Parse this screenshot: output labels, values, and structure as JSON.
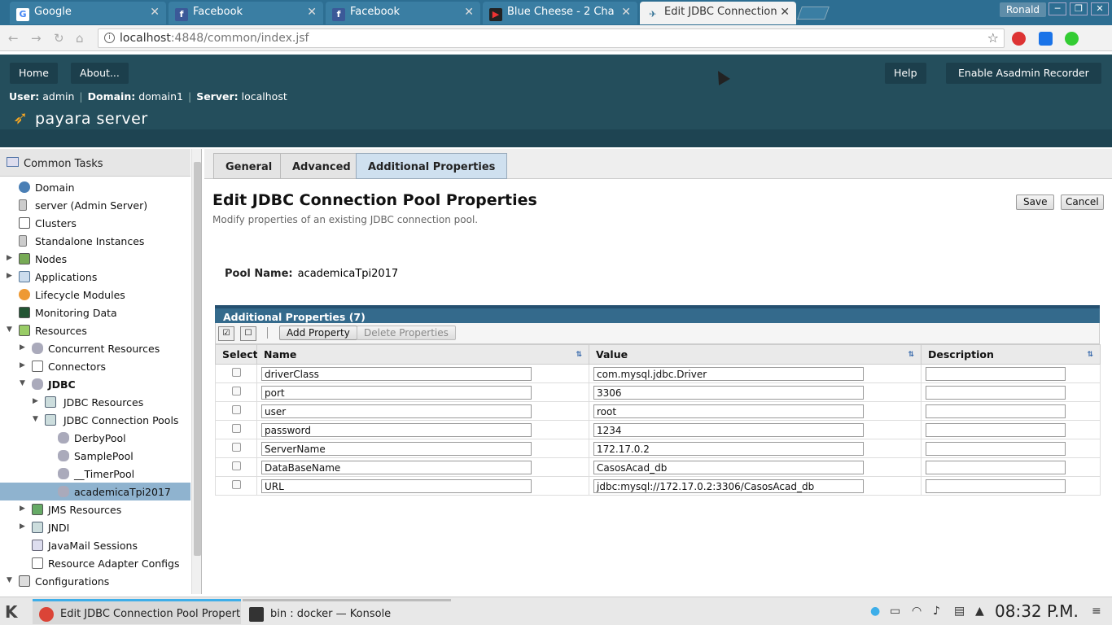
{
  "browser": {
    "tabs": [
      {
        "title": "Google"
      },
      {
        "title": "Facebook"
      },
      {
        "title": "Facebook"
      },
      {
        "title": "Blue Cheese - 2 Cha"
      },
      {
        "title": "Edit JDBC Connection"
      }
    ],
    "user_badge": "Ronald",
    "url_host": "localhost",
    "url_path": ":4848/common/index.jsf"
  },
  "masthead": {
    "home": "Home",
    "about": "About...",
    "help": "Help",
    "recorder": "Enable Asadmin Recorder",
    "user_label": "User:",
    "user_value": "admin",
    "domain_label": "Domain:",
    "domain_value": "domain1",
    "server_label": "Server:",
    "server_value": "localhost",
    "logo": "payara server"
  },
  "sidebar": {
    "header": "Common Tasks",
    "items": [
      {
        "label": "Domain"
      },
      {
        "label": "server (Admin Server)"
      },
      {
        "label": "Clusters"
      },
      {
        "label": "Standalone Instances"
      },
      {
        "label": "Nodes"
      },
      {
        "label": "Applications"
      },
      {
        "label": "Lifecycle Modules"
      },
      {
        "label": "Monitoring Data"
      },
      {
        "label": "Resources"
      },
      {
        "label": "Concurrent Resources"
      },
      {
        "label": "Connectors"
      },
      {
        "label": "JDBC"
      },
      {
        "label": "JDBC Resources"
      },
      {
        "label": "JDBC Connection Pools"
      },
      {
        "label": "DerbyPool"
      },
      {
        "label": "SamplePool"
      },
      {
        "label": "__TimerPool"
      },
      {
        "label": "academicaTpi2017"
      },
      {
        "label": "JMS Resources"
      },
      {
        "label": "JNDI"
      },
      {
        "label": "JavaMail Sessions"
      },
      {
        "label": "Resource Adapter Configs"
      },
      {
        "label": "Configurations"
      }
    ]
  },
  "page": {
    "tabs": [
      {
        "label": "General"
      },
      {
        "label": "Advanced"
      },
      {
        "label": "Additional Properties"
      }
    ],
    "title": "Edit JDBC Connection Pool Properties",
    "subtitle": "Modify properties of an existing JDBC connection pool.",
    "save": "Save",
    "cancel": "Cancel",
    "pool_label": "Pool Name:",
    "pool_value": "academicaTpi2017"
  },
  "props": {
    "title": "Additional Properties (7)",
    "add": "Add Property",
    "delete": "Delete Properties",
    "columns": {
      "select": "Select",
      "name": "Name",
      "value": "Value",
      "description": "Description"
    },
    "rows": [
      {
        "name": "driverClass",
        "value": "com.mysql.jdbc.Driver",
        "description": ""
      },
      {
        "name": "port",
        "value": "3306",
        "description": ""
      },
      {
        "name": "user",
        "value": "root",
        "description": ""
      },
      {
        "name": "password",
        "value": "1234",
        "description": ""
      },
      {
        "name": "ServerName",
        "value": "172.17.0.2",
        "description": ""
      },
      {
        "name": "DataBaseName",
        "value": "CasosAcad_db",
        "description": ""
      },
      {
        "name": "URL",
        "value": "jdbc:mysql://172.17.0.2:3306/CasosAcad_db",
        "description": ""
      }
    ]
  },
  "taskbar": {
    "task1": "Edit JDBC Connection Pool Properti...",
    "task2": "bin : docker — Konsole",
    "clock": "08:32 P.M."
  }
}
